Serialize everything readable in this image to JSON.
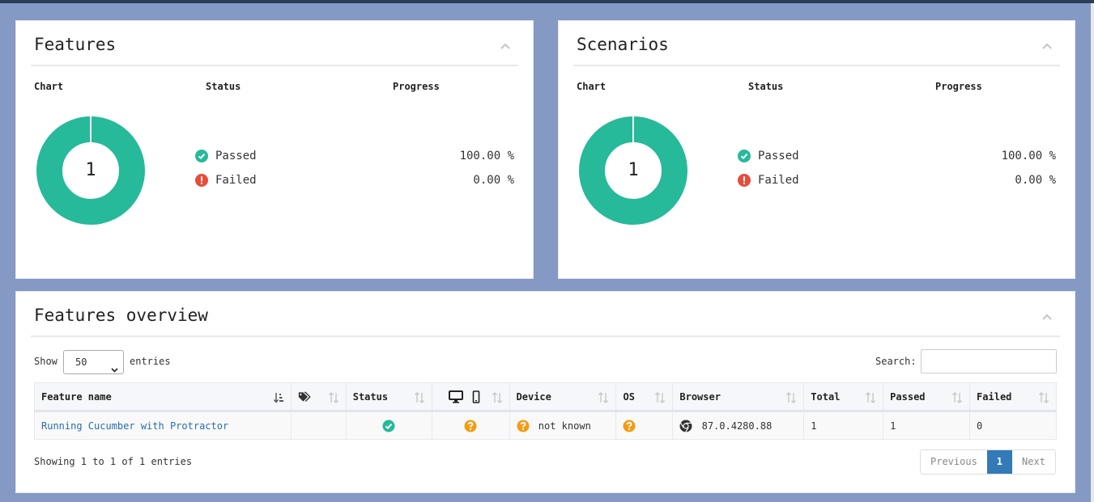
{
  "features_panel": {
    "title": "Features",
    "col_chart": "Chart",
    "col_status": "Status",
    "col_progress": "Progress",
    "donut_total": "1",
    "passed_label": "Passed",
    "passed_pct": "100.00 %",
    "failed_label": "Failed",
    "failed_pct": "0.00 %",
    "passed_fraction": 1.0
  },
  "scenarios_panel": {
    "title": "Scenarios",
    "col_chart": "Chart",
    "col_status": "Status",
    "col_progress": "Progress",
    "donut_total": "1",
    "passed_label": "Passed",
    "passed_pct": "100.00 %",
    "failed_label": "Failed",
    "failed_pct": "0.00 %",
    "passed_fraction": 1.0
  },
  "overview": {
    "title": "Features overview",
    "show_label": "Show",
    "entries_value": "50",
    "entries_label": "entries",
    "search_label": "Search:",
    "search_value": "",
    "headers": {
      "feature_name": "Feature name",
      "status": "Status",
      "device": "Device",
      "os": "OS",
      "browser": "Browser",
      "total": "Total",
      "passed": "Passed",
      "failed": "Failed"
    },
    "rows": [
      {
        "feature_name": "Running Cucumber with Protractor",
        "device": "not known",
        "browser_version": "87.0.4280.88",
        "total": "1",
        "passed": "1",
        "failed": "0"
      }
    ],
    "info": "Showing 1 to 1 of 1 entries",
    "pager": {
      "previous": "Previous",
      "current": "1",
      "next": "Next"
    }
  },
  "colors": {
    "passed": "#26b99a",
    "failed": "#e74c3c",
    "unknown": "#f39c12",
    "page_bg": "#8499c4",
    "link": "#2a6db0"
  }
}
